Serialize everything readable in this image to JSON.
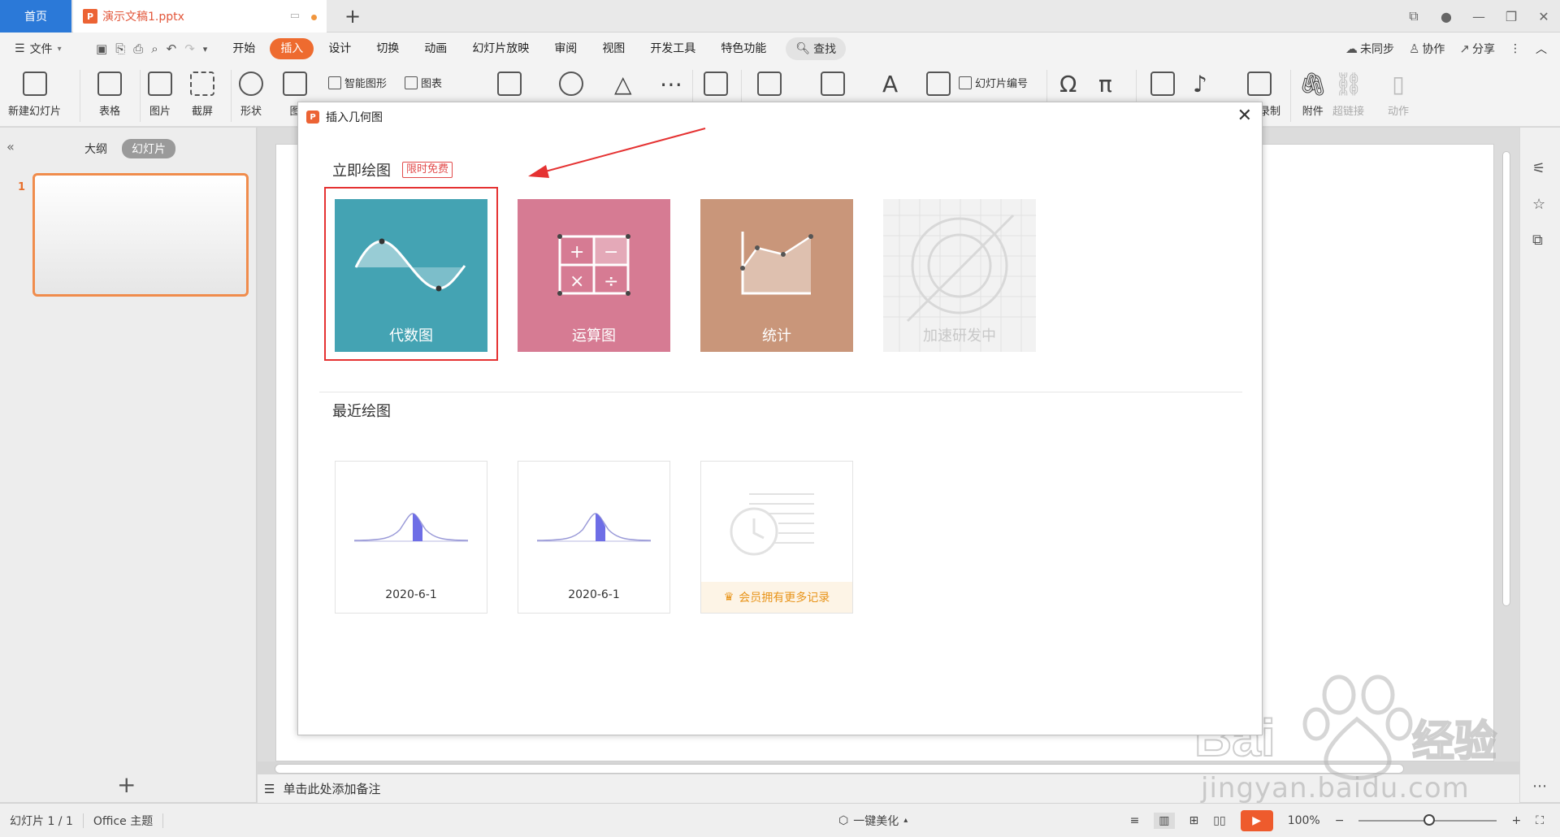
{
  "titlebar": {
    "home_tab": "首页",
    "doc_tab": "演示文稿1.pptx",
    "doc_icon_letter": "P"
  },
  "menubar": {
    "file_label": "文件",
    "tabs": [
      "开始",
      "插入",
      "设计",
      "切换",
      "动画",
      "幻灯片放映",
      "审阅",
      "视图",
      "开发工具",
      "特色功能"
    ],
    "active_tab": "插入",
    "search_label": "查找",
    "sync_label": "未同步",
    "collab_label": "协作",
    "share_label": "分享"
  },
  "ribbon": {
    "new_slide": "新建幻灯片",
    "table": "表格",
    "picture": "图片",
    "screenshot": "截屏",
    "shape": "形状",
    "icon_lib": "图",
    "smart_art": "智能图形",
    "chart": "图表",
    "slide_number": "幻灯片编号",
    "record": "录制",
    "attachment": "附件",
    "hyperlink": "超链接",
    "action": "动作"
  },
  "leftpanel": {
    "outline_tab": "大纲",
    "slides_tab": "幻灯片",
    "slide_number": "1"
  },
  "notes_placeholder": "单击此处添加备注",
  "statusbar": {
    "slide_info": "幻灯片 1 / 1",
    "theme": "Office 主题",
    "beautify": "一键美化",
    "zoom": "100%"
  },
  "dialog": {
    "title": "插入几何图",
    "section_instant": "立即绘图",
    "free_badge": "限时免费",
    "section_recent": "最近绘图",
    "cards": [
      {
        "label": "代数图",
        "color": "#44a3b3"
      },
      {
        "label": "运算图",
        "color": "#d67b93"
      },
      {
        "label": "统计",
        "color": "#c9967a"
      },
      {
        "label": "加速研发中",
        "color": "#f2f2f2"
      }
    ],
    "recent": [
      {
        "date": "2020-6-1"
      },
      {
        "date": "2020-6-1"
      }
    ],
    "vip_more": "会员拥有更多记录"
  },
  "watermark": {
    "brand": "Baidu经验",
    "url": "jingyan.baidu.com"
  }
}
